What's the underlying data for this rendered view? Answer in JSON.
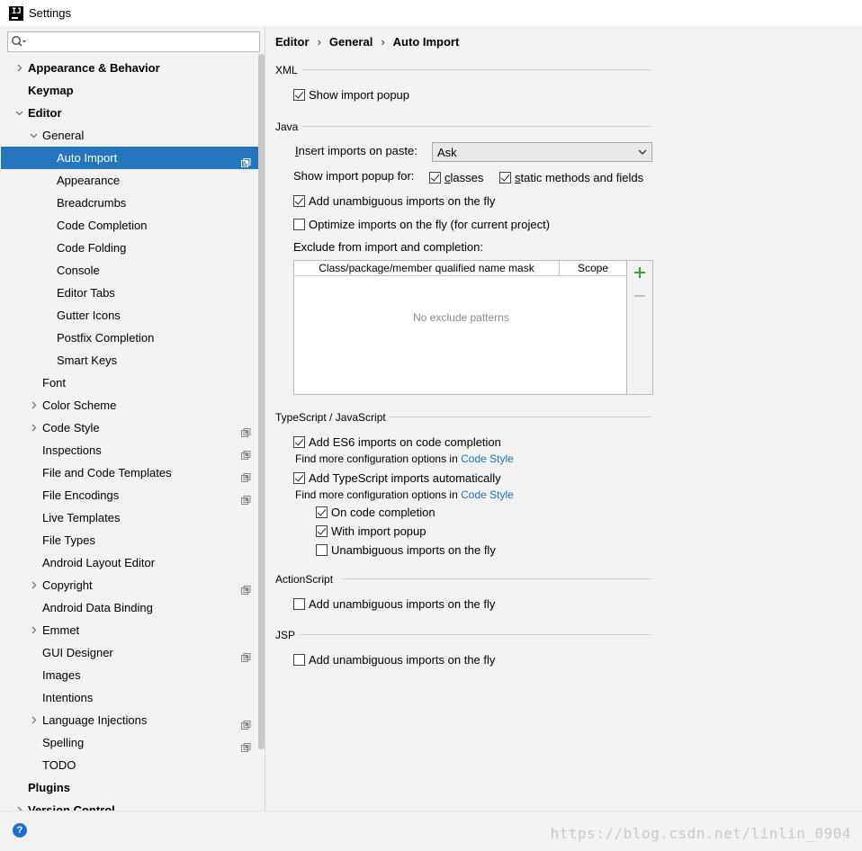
{
  "window": {
    "title": "Settings"
  },
  "search": {
    "placeholder": ""
  },
  "tree": [
    {
      "label": "Appearance & Behavior",
      "level": 0,
      "bold": true,
      "arrow": "right"
    },
    {
      "label": "Keymap",
      "level": 0,
      "bold": true,
      "arrow": "none"
    },
    {
      "label": "Editor",
      "level": 0,
      "bold": true,
      "arrow": "down"
    },
    {
      "label": "General",
      "level": 1,
      "bold": false,
      "arrow": "down"
    },
    {
      "label": "Auto Import",
      "level": 2,
      "bold": false,
      "arrow": "none",
      "selected": true,
      "project": true
    },
    {
      "label": "Appearance",
      "level": 2,
      "bold": false,
      "arrow": "none"
    },
    {
      "label": "Breadcrumbs",
      "level": 2,
      "bold": false,
      "arrow": "none"
    },
    {
      "label": "Code Completion",
      "level": 2,
      "bold": false,
      "arrow": "none"
    },
    {
      "label": "Code Folding",
      "level": 2,
      "bold": false,
      "arrow": "none"
    },
    {
      "label": "Console",
      "level": 2,
      "bold": false,
      "arrow": "none"
    },
    {
      "label": "Editor Tabs",
      "level": 2,
      "bold": false,
      "arrow": "none"
    },
    {
      "label": "Gutter Icons",
      "level": 2,
      "bold": false,
      "arrow": "none"
    },
    {
      "label": "Postfix Completion",
      "level": 2,
      "bold": false,
      "arrow": "none"
    },
    {
      "label": "Smart Keys",
      "level": 2,
      "bold": false,
      "arrow": "none"
    },
    {
      "label": "Font",
      "level": 1,
      "bold": false,
      "arrow": "none"
    },
    {
      "label": "Color Scheme",
      "level": 1,
      "bold": false,
      "arrow": "right"
    },
    {
      "label": "Code Style",
      "level": 1,
      "bold": false,
      "arrow": "right",
      "project": true
    },
    {
      "label": "Inspections",
      "level": 1,
      "bold": false,
      "arrow": "none",
      "project": true
    },
    {
      "label": "File and Code Templates",
      "level": 1,
      "bold": false,
      "arrow": "none",
      "project": true
    },
    {
      "label": "File Encodings",
      "level": 1,
      "bold": false,
      "arrow": "none",
      "project": true
    },
    {
      "label": "Live Templates",
      "level": 1,
      "bold": false,
      "arrow": "none"
    },
    {
      "label": "File Types",
      "level": 1,
      "bold": false,
      "arrow": "none"
    },
    {
      "label": "Android Layout Editor",
      "level": 1,
      "bold": false,
      "arrow": "none"
    },
    {
      "label": "Copyright",
      "level": 1,
      "bold": false,
      "arrow": "right",
      "project": true
    },
    {
      "label": "Android Data Binding",
      "level": 1,
      "bold": false,
      "arrow": "none"
    },
    {
      "label": "Emmet",
      "level": 1,
      "bold": false,
      "arrow": "right"
    },
    {
      "label": "GUI Designer",
      "level": 1,
      "bold": false,
      "arrow": "none",
      "project": true
    },
    {
      "label": "Images",
      "level": 1,
      "bold": false,
      "arrow": "none"
    },
    {
      "label": "Intentions",
      "level": 1,
      "bold": false,
      "arrow": "none"
    },
    {
      "label": "Language Injections",
      "level": 1,
      "bold": false,
      "arrow": "right",
      "project": true
    },
    {
      "label": "Spelling",
      "level": 1,
      "bold": false,
      "arrow": "none",
      "project": true
    },
    {
      "label": "TODO",
      "level": 1,
      "bold": false,
      "arrow": "none"
    },
    {
      "label": "Plugins",
      "level": 0,
      "bold": true,
      "arrow": "none"
    },
    {
      "label": "Version Control",
      "level": 0,
      "bold": true,
      "arrow": "right",
      "project": true
    }
  ],
  "breadcrumb": {
    "part1": "Editor",
    "sep": "›",
    "part2": "General",
    "part3": "Auto Import"
  },
  "xml": {
    "title": "XML",
    "show_import_popup": {
      "label": "Show import popup",
      "checked": true
    }
  },
  "java": {
    "title": "Java",
    "insert_on_paste_pre": "I",
    "insert_on_paste_rest": "nsert imports on paste:",
    "insert_on_paste_value": "Ask",
    "show_popup_for": "Show import popup for:",
    "classes_u": "c",
    "classes_rest": "lasses",
    "classes_checked": true,
    "static_u": "s",
    "static_rest": "tatic methods and fields",
    "static_checked": true,
    "add_unambiguous": {
      "label": "Add unambiguous imports on the fly",
      "checked": true
    },
    "optimize": {
      "label": "Optimize imports on the fly (for current project)",
      "checked": false
    },
    "exclude_label": "Exclude from import and completion:",
    "exclude_col1": "Class/package/member qualified name mask",
    "exclude_col2": "Scope",
    "exclude_empty": "No exclude patterns"
  },
  "ts": {
    "title": "TypeScript / JavaScript",
    "es6": {
      "label": "Add ES6 imports on code completion",
      "checked": true
    },
    "hint1_text": "Find more configuration options in ",
    "hint1_link": "Code Style",
    "ts_auto": {
      "label": "Add TypeScript imports automatically",
      "checked": true
    },
    "hint2_text": "Find more configuration options in ",
    "hint2_link": "Code Style",
    "on_completion": {
      "label": "On code completion",
      "checked": true
    },
    "with_popup": {
      "label": "With import popup",
      "checked": true
    },
    "unambiguous": {
      "label": "Unambiguous imports on the fly",
      "checked": false
    }
  },
  "actionscript": {
    "title": "ActionScript",
    "add_unambiguous": {
      "label": "Add unambiguous imports on the fly",
      "checked": false
    }
  },
  "jsp": {
    "title": "JSP",
    "add_unambiguous": {
      "label": "Add unambiguous imports on the fly",
      "checked": false
    }
  },
  "footer": {
    "help": "?",
    "watermark": "https://blog.csdn.net/linlin_0904"
  },
  "colors": {
    "selection": "#2675bf",
    "link": "#2470b3",
    "add_green": "#3a9b3a"
  }
}
